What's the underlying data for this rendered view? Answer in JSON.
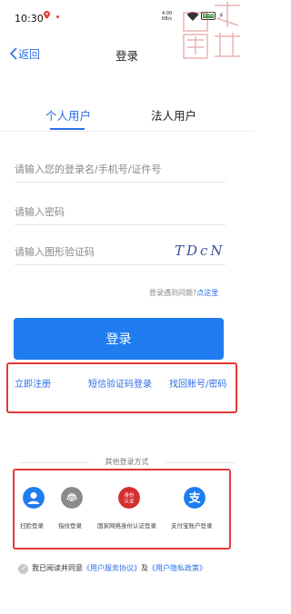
{
  "status_bar": {
    "time": "10:30",
    "net_speed_top": "4.00",
    "net_speed_unit": "KB/s",
    "battery_level": 100
  },
  "header": {
    "back_label": "返回",
    "title": "登录"
  },
  "tabs": [
    {
      "label": "个人用户",
      "active": true
    },
    {
      "label": "法人用户",
      "active": false
    }
  ],
  "form": {
    "username_placeholder": "请输入您的登录名/手机号/证件号",
    "password_placeholder": "请输入密码",
    "captcha_placeholder": "请输入图形验证码",
    "captcha_text": "TDcN",
    "help_text": "登录遇到问题?",
    "help_link": "点这里",
    "login_button": "登录"
  },
  "links": {
    "register": "立即注册",
    "sms_login": "短信验证码登录",
    "recover": "找回账号/密码"
  },
  "other_methods": {
    "title": "其他登录方式",
    "items": [
      {
        "label": "扫脸登录",
        "icon": "face-scan-icon",
        "color": "#1f7df0"
      },
      {
        "label": "指纹登录",
        "icon": "fingerprint-icon",
        "color": "#8a8a8a"
      },
      {
        "label": "国家网络身份认证登录",
        "icon": "id-auth-icon",
        "color": "#d32f2f",
        "icon_text": "身份认证"
      },
      {
        "label": "支付宝账户登录",
        "icon": "alipay-icon",
        "color": "#1f7df0"
      }
    ]
  },
  "agreement": {
    "prefix": "我已阅读并同意",
    "service": "《用户服务协议》",
    "and": "及",
    "privacy": "《用户隐私政策》"
  },
  "colors": {
    "accent": "#1f7df0",
    "link": "#2b6ee8",
    "highlight_box": "#e53935"
  }
}
